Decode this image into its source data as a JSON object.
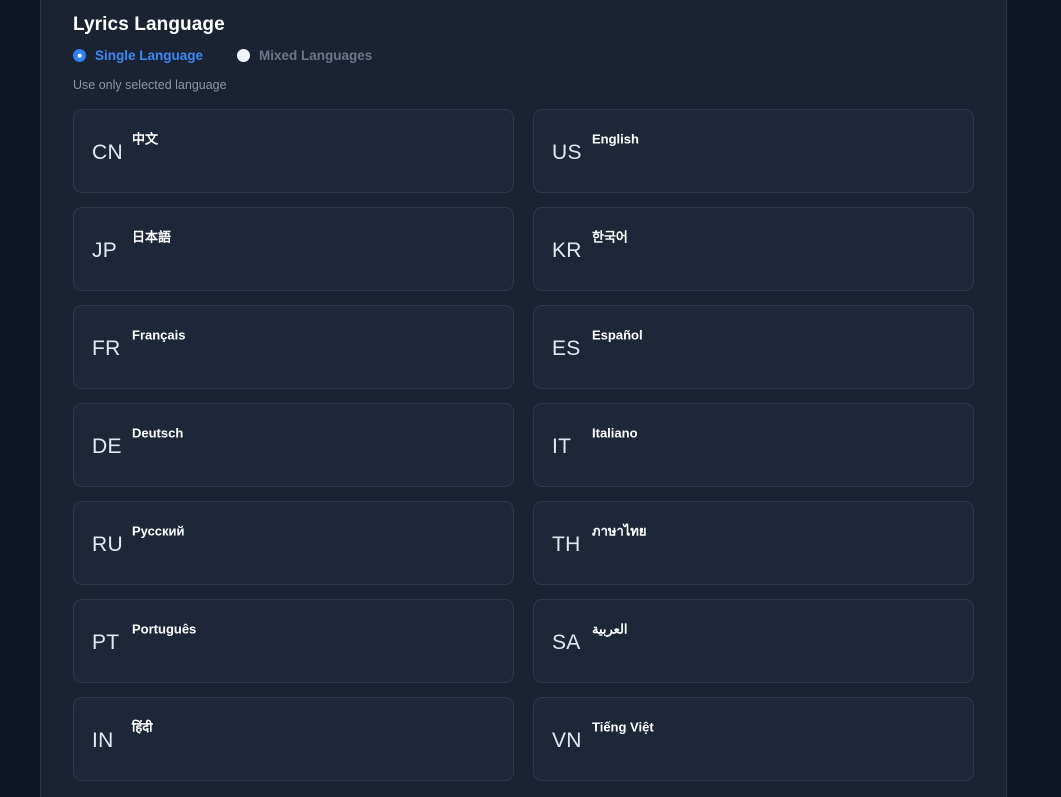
{
  "section": {
    "title": "Lyrics Language",
    "hint": "Use only selected language"
  },
  "mode": {
    "single_label": "Single Language",
    "mixed_label": "Mixed Languages",
    "selected": "single",
    "accent_color": "#3b88f5"
  },
  "languages": [
    {
      "code": "CN",
      "native": "中文"
    },
    {
      "code": "US",
      "native": "English"
    },
    {
      "code": "JP",
      "native": "日本語"
    },
    {
      "code": "KR",
      "native": "한국어"
    },
    {
      "code": "FR",
      "native": "Français"
    },
    {
      "code": "ES",
      "native": "Español"
    },
    {
      "code": "DE",
      "native": "Deutsch"
    },
    {
      "code": "IT",
      "native": "Italiano"
    },
    {
      "code": "RU",
      "native": "Русский"
    },
    {
      "code": "TH",
      "native": "ภาษาไทย"
    },
    {
      "code": "PT",
      "native": "Português"
    },
    {
      "code": "SA",
      "native": "العربية"
    },
    {
      "code": "IN",
      "native": "हिंदी"
    },
    {
      "code": "VN",
      "native": "Tiếng Việt"
    }
  ]
}
